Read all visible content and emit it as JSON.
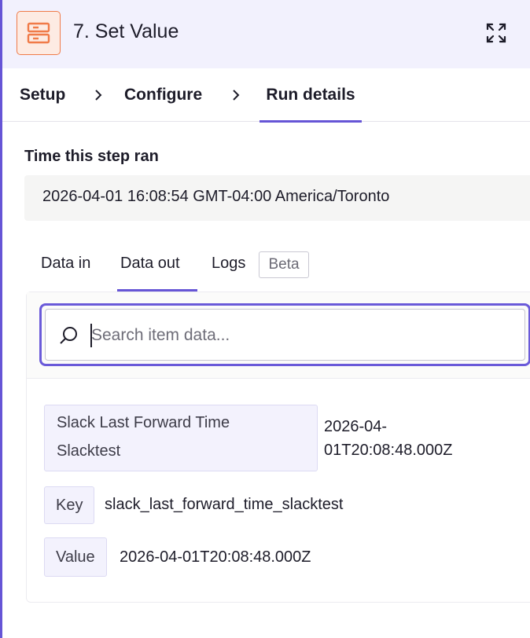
{
  "header": {
    "title": "7. Set Value",
    "app_icon": "storage-icon",
    "expand_icon": "expand-icon",
    "accent_color": "#f07b49"
  },
  "steps": [
    {
      "label": "Setup"
    },
    {
      "label": "Configure"
    },
    {
      "label": "Run details",
      "active": true
    }
  ],
  "time_section": {
    "label": "Time this step ran",
    "value": "2026-04-01 16:08:54 GMT-04:00 America/Toronto"
  },
  "data_tabs": {
    "data_in": "Data in",
    "data_out": "Data out",
    "logs": "Logs",
    "beta_badge": "Beta",
    "active": "Data out"
  },
  "search": {
    "placeholder": "Search item data...",
    "value": ""
  },
  "items": {
    "title_line1": "Slack Last Forward Time",
    "title_line2": "Slacktest",
    "title_value_line1": "2026-04-",
    "title_value_line2": "01T20:08:48.000Z",
    "key_label": "Key",
    "key_value": "slack_last_forward_time_slacktest",
    "value_label": "Value",
    "value_value": "2026-04-01T20:08:48.000Z"
  },
  "colors": {
    "accent": "#6655d6",
    "header_bg": "#f2f1fd"
  }
}
